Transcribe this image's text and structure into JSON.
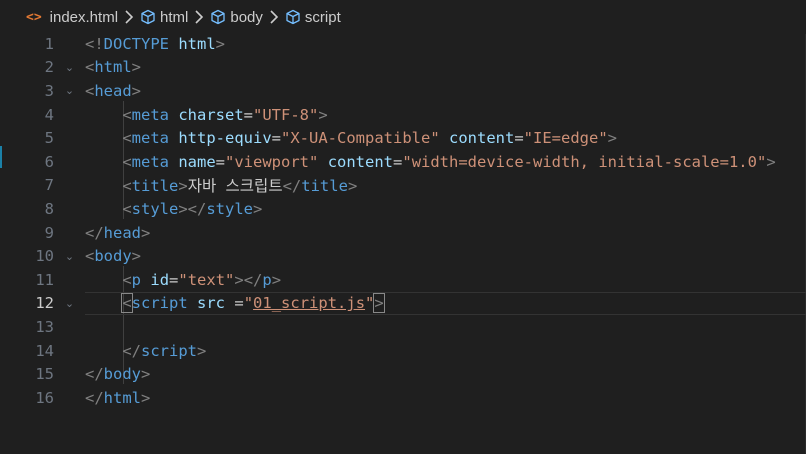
{
  "breadcrumb": {
    "file_icon": "<>",
    "file": "index.html",
    "items": [
      "html",
      "body",
      "script"
    ]
  },
  "editor": {
    "lines": [
      {
        "num": "1",
        "fold": false,
        "tokens": [
          [
            "p",
            "<!"
          ],
          [
            "t",
            "DOCTYPE"
          ],
          [
            "x",
            " "
          ],
          [
            "a",
            "html"
          ],
          [
            "p",
            ">"
          ]
        ]
      },
      {
        "num": "2",
        "fold": true,
        "tokens": [
          [
            "p",
            "<"
          ],
          [
            "t",
            "html"
          ],
          [
            "p",
            ">"
          ]
        ]
      },
      {
        "num": "3",
        "fold": true,
        "tokens": [
          [
            "p",
            "<"
          ],
          [
            "t",
            "head"
          ],
          [
            "p",
            ">"
          ]
        ]
      },
      {
        "num": "4",
        "fold": false,
        "tokens": [
          [
            "x",
            "    "
          ],
          [
            "p",
            "<"
          ],
          [
            "t",
            "meta"
          ],
          [
            "x",
            " "
          ],
          [
            "a",
            "charset"
          ],
          [
            "e",
            "="
          ],
          [
            "s",
            "\"UTF-8\""
          ],
          [
            "p",
            ">"
          ]
        ]
      },
      {
        "num": "5",
        "fold": false,
        "tokens": [
          [
            "x",
            "    "
          ],
          [
            "p",
            "<"
          ],
          [
            "t",
            "meta"
          ],
          [
            "x",
            " "
          ],
          [
            "a",
            "http-equiv"
          ],
          [
            "e",
            "="
          ],
          [
            "s",
            "\"X-UA-Compatible\""
          ],
          [
            "x",
            " "
          ],
          [
            "a",
            "content"
          ],
          [
            "e",
            "="
          ],
          [
            "s",
            "\"IE=edge\""
          ],
          [
            "p",
            ">"
          ]
        ]
      },
      {
        "num": "6",
        "fold": false,
        "tokens": [
          [
            "x",
            "    "
          ],
          [
            "p",
            "<"
          ],
          [
            "t",
            "meta"
          ],
          [
            "x",
            " "
          ],
          [
            "a",
            "name"
          ],
          [
            "e",
            "="
          ],
          [
            "s",
            "\"viewport\""
          ],
          [
            "x",
            " "
          ],
          [
            "a",
            "content"
          ],
          [
            "e",
            "="
          ],
          [
            "s",
            "\"width=device-width, initial-scale=1.0\""
          ],
          [
            "p",
            ">"
          ]
        ]
      },
      {
        "num": "7",
        "fold": false,
        "tokens": [
          [
            "x",
            "    "
          ],
          [
            "p",
            "<"
          ],
          [
            "t",
            "title"
          ],
          [
            "p",
            ">"
          ],
          [
            "x",
            "자바 스크립트"
          ],
          [
            "p",
            "</"
          ],
          [
            "t",
            "title"
          ],
          [
            "p",
            ">"
          ]
        ]
      },
      {
        "num": "8",
        "fold": false,
        "tokens": [
          [
            "x",
            "    "
          ],
          [
            "p",
            "<"
          ],
          [
            "t",
            "style"
          ],
          [
            "p",
            "></"
          ],
          [
            "t",
            "style"
          ],
          [
            "p",
            ">"
          ]
        ]
      },
      {
        "num": "9",
        "fold": false,
        "tokens": [
          [
            "p",
            "</"
          ],
          [
            "t",
            "head"
          ],
          [
            "p",
            ">"
          ]
        ]
      },
      {
        "num": "10",
        "fold": true,
        "tokens": [
          [
            "p",
            "<"
          ],
          [
            "t",
            "body"
          ],
          [
            "p",
            ">"
          ]
        ]
      },
      {
        "num": "11",
        "fold": false,
        "tokens": [
          [
            "x",
            "    "
          ],
          [
            "p",
            "<"
          ],
          [
            "t",
            "p"
          ],
          [
            "x",
            " "
          ],
          [
            "a",
            "id"
          ],
          [
            "e",
            "="
          ],
          [
            "s",
            "\"text\""
          ],
          [
            "p",
            "></"
          ],
          [
            "t",
            "p"
          ],
          [
            "p",
            ">"
          ]
        ]
      },
      {
        "num": "12",
        "fold": true,
        "current": true,
        "tokens": [
          [
            "x",
            "    "
          ],
          [
            "ph",
            "<"
          ],
          [
            "t",
            "script"
          ],
          [
            "x",
            " "
          ],
          [
            "a",
            "src"
          ],
          [
            "x",
            " "
          ],
          [
            "e",
            "="
          ],
          [
            "s",
            "\""
          ],
          [
            "su",
            "01_script.js"
          ],
          [
            "s",
            "\""
          ],
          [
            "ph",
            ">"
          ]
        ]
      },
      {
        "num": "13",
        "fold": false,
        "tokens": []
      },
      {
        "num": "14",
        "fold": false,
        "tokens": [
          [
            "x",
            "    "
          ],
          [
            "p",
            "</"
          ],
          [
            "t",
            "script"
          ],
          [
            "p",
            ">"
          ]
        ]
      },
      {
        "num": "15",
        "fold": false,
        "tokens": [
          [
            "p",
            "</"
          ],
          [
            "t",
            "body"
          ],
          [
            "p",
            ">"
          ]
        ]
      },
      {
        "num": "16",
        "fold": false,
        "tokens": [
          [
            "p",
            "</"
          ],
          [
            "t",
            "html"
          ],
          [
            "p",
            ">"
          ]
        ]
      }
    ]
  },
  "colors": {
    "background": "#1f1f1f",
    "tag": "#569cd6",
    "attribute": "#9cdcfe",
    "string": "#ce9178",
    "punctuation": "#808080",
    "line_number": "#6e7681"
  }
}
